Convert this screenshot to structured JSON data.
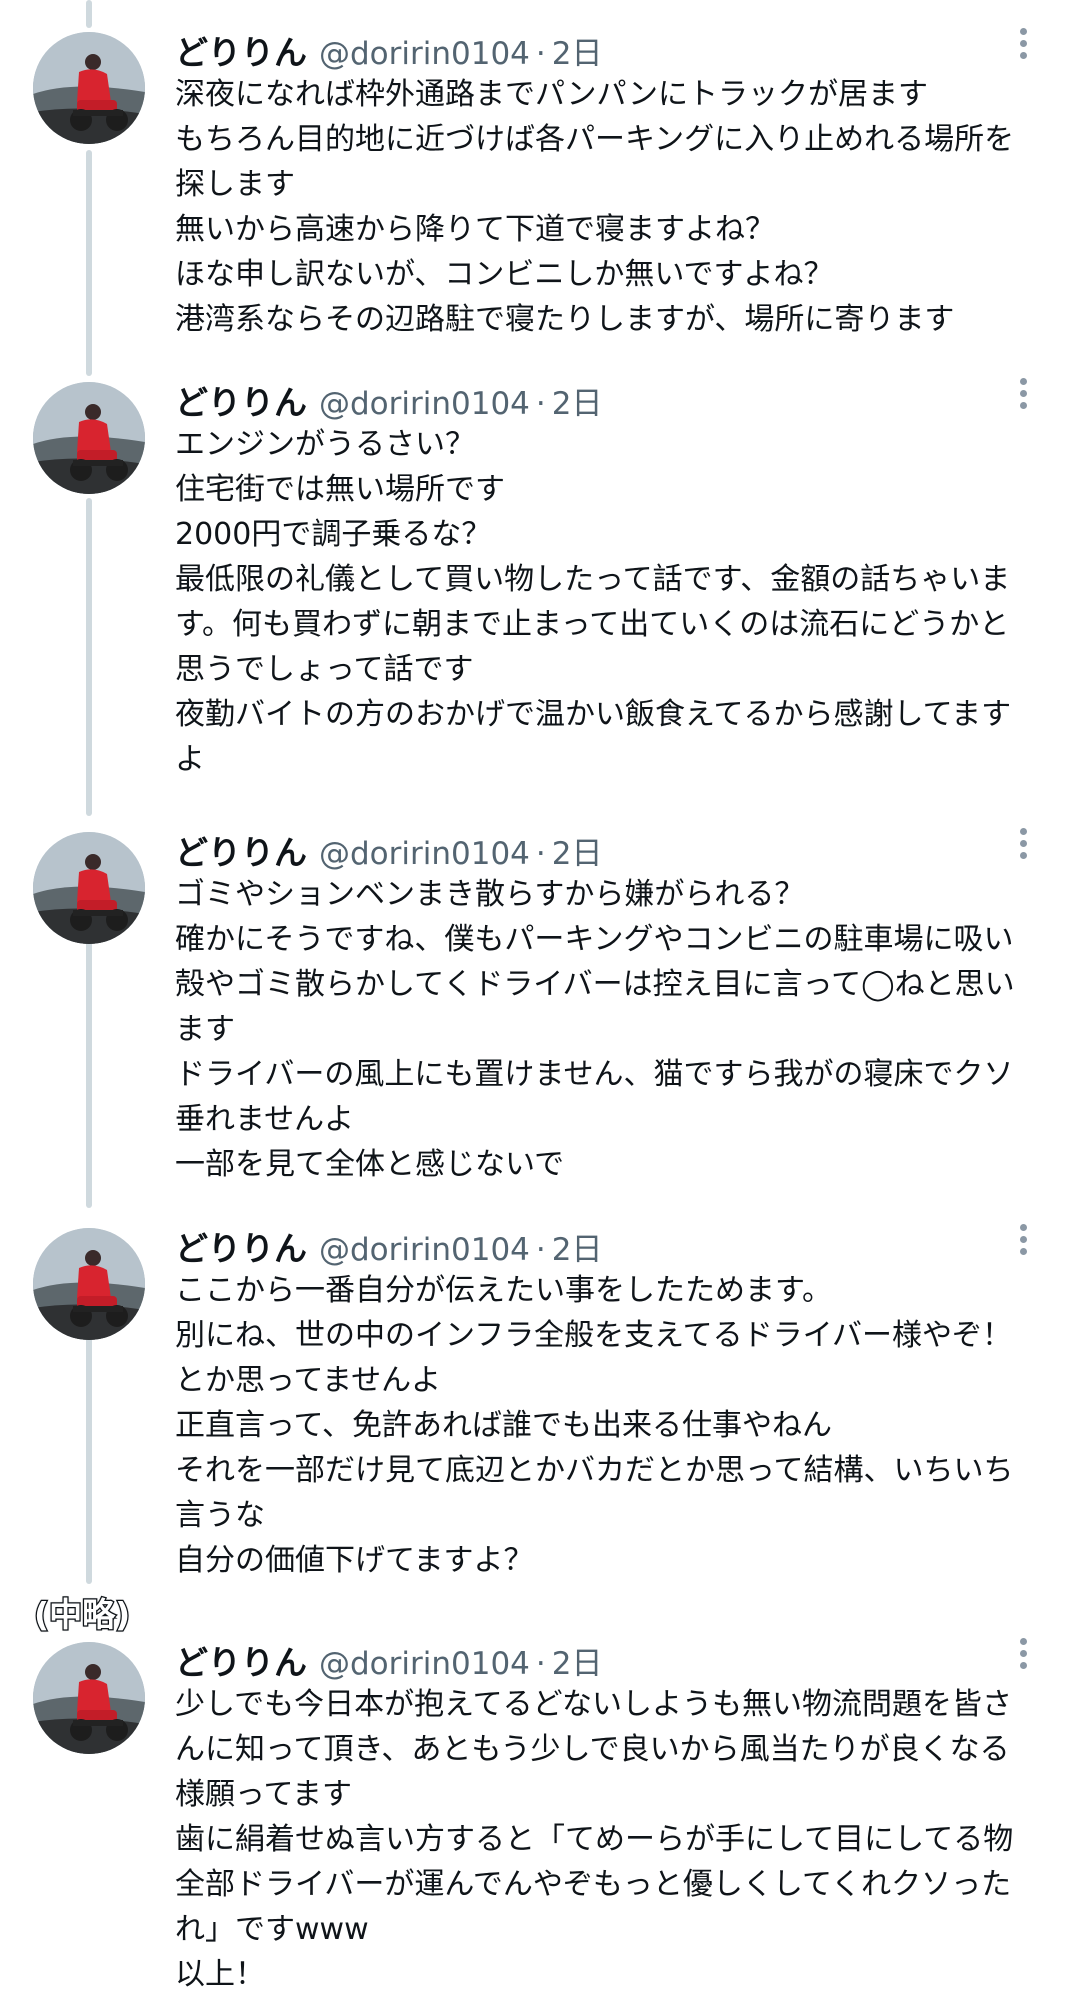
{
  "tweets": [
    {
      "display_name": "どりりん",
      "handle": "@doririn0104",
      "separator": "·",
      "time": "2日",
      "lines": [
        "深夜になれば枠外通路までパンパンにトラックが居ます",
        "もちろん目的地に近づけば各パーキングに入り止めれる場所を",
        "探します",
        "無いから高速から降りて下道で寝ますよね？",
        "ほな申し訳ないが、コンビニしか無いですよね？",
        "港湾系ならその辺路駐で寝たりしますが、場所に寄ります"
      ]
    },
    {
      "display_name": "どりりん",
      "handle": "@doririn0104",
      "separator": "·",
      "time": "2日",
      "lines": [
        "エンジンがうるさい？",
        "住宅街では無い場所です",
        "2000円で調子乗るな？",
        "最低限の礼儀として買い物したって話です、金額の話ちゃいま",
        "す。何も買わずに朝まで止まって出ていくのは流石にどうかと",
        "思うでしょって話です",
        "夜勤バイトの方のおかげで温かい飯食えてるから感謝してます",
        "よ"
      ]
    },
    {
      "display_name": "どりりん",
      "handle": "@doririn0104",
      "separator": "·",
      "time": "2日",
      "lines": [
        "ゴミやションベンまき散らすから嫌がられる？",
        "確かにそうですね、僕もパーキングやコンビニの駐車場に吸い",
        "殻やゴミ散らかしてくドライバーは控え目に言って◯ねと思い",
        "ます",
        "ドライバーの風上にも置けません、猫ですら我がの寝床でクソ",
        "垂れませんよ",
        "一部を見て全体と感じないで"
      ]
    },
    {
      "display_name": "どりりん",
      "handle": "@doririn0104",
      "separator": "·",
      "time": "2日",
      "lines": [
        "ここから一番自分が伝えたい事をしたためます。",
        "別にね、世の中のインフラ全般を支えてるドライバー様やぞ！",
        "とか思ってませんよ",
        "正直言って、免許あれば誰でも出来る仕事やねん",
        "それを一部だけ見て底辺とかバカだとか思って結構、いちいち",
        "言うな",
        "自分の価値下げてますよ？"
      ]
    },
    {
      "display_name": "どりりん",
      "handle": "@doririn0104",
      "separator": "·",
      "time": "2日",
      "lines": [
        "少しでも今日本が抱えてるどないしようも無い物流問題を皆さ",
        "んに知って頂き、あともう少しで良いから風当たりが良くなる",
        "様願ってます",
        "歯に絹着せぬ言い方すると「てめーらが手にして目にしてる物",
        "全部ドライバーが運んでんやぞもっと優しくしてくれクソった",
        "れ」ですwww",
        "以上！"
      ]
    }
  ],
  "omitted_label": "(中略)",
  "colors": {
    "text": "#0f1419",
    "secondary": "#536471",
    "thread_line": "#cfd9de"
  },
  "icons": [
    "more-options-icon",
    "avatar-image"
  ]
}
